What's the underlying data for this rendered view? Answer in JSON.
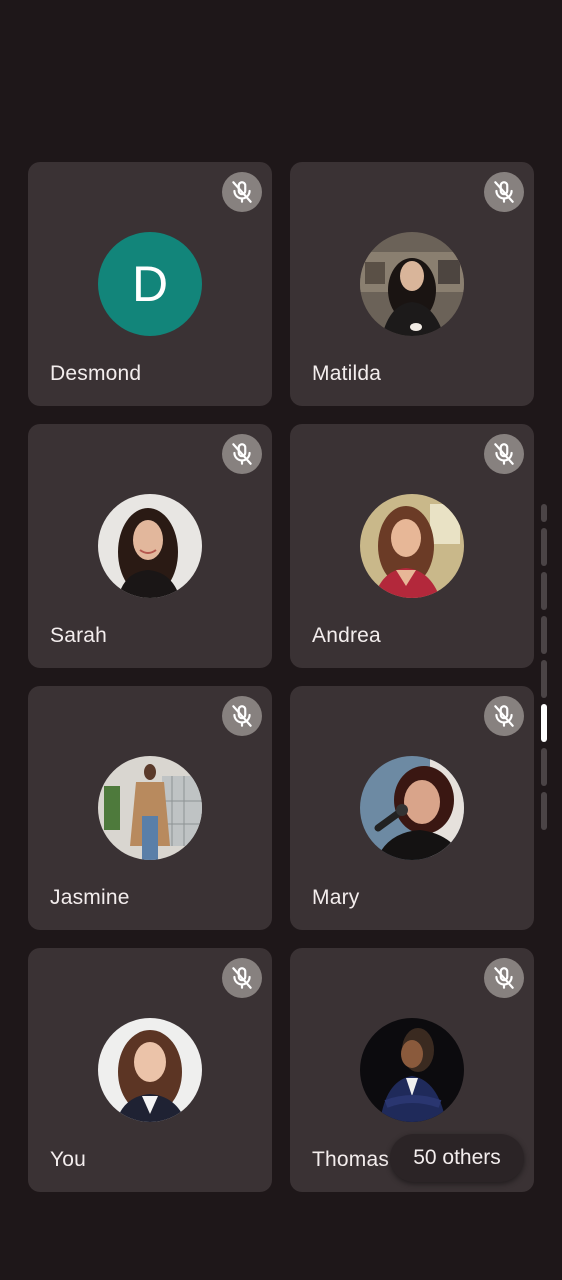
{
  "participants": [
    {
      "name": "Desmond",
      "initial": "D",
      "avatar": "initial-avatar",
      "avatar_color": "#12857a"
    },
    {
      "name": "Matilda",
      "avatar": "photo-avatar"
    },
    {
      "name": "Sarah",
      "avatar": "photo-avatar"
    },
    {
      "name": "Andrea",
      "avatar": "photo-avatar"
    },
    {
      "name": "Jasmine",
      "avatar": "photo-avatar"
    },
    {
      "name": "Mary",
      "avatar": "photo-avatar"
    },
    {
      "name": "You",
      "avatar": "photo-avatar"
    },
    {
      "name": "Thomas",
      "avatar": "photo-avatar"
    }
  ],
  "mute_icon": "mic-off-icon",
  "others_chip": {
    "label": "50 others"
  },
  "scroll_indicator": {
    "segments": 8,
    "active_index": 5
  },
  "colors": {
    "background": "#1e1719",
    "tile": "#3a3234",
    "mute_badge": "#87817f",
    "text": "#f3eded"
  }
}
